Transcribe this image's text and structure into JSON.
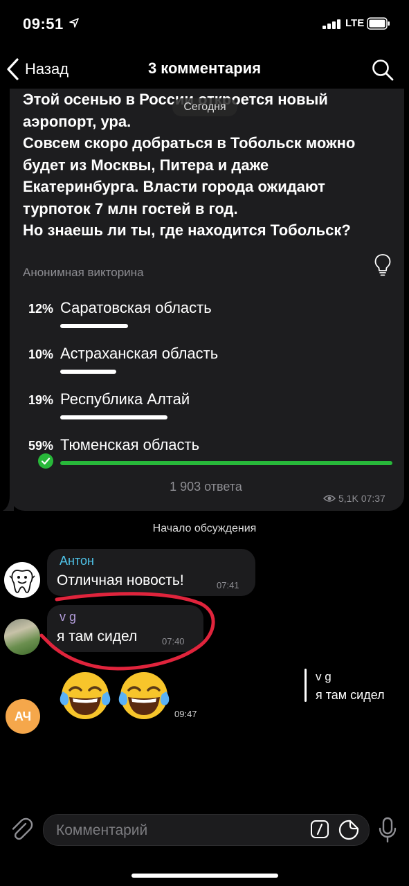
{
  "status_bar": {
    "time": "09:51",
    "network": "LTE"
  },
  "header": {
    "back_label": "Назад",
    "title": "3 комментария"
  },
  "post": {
    "text": "Этой осенью в России откроется новый аэропорт, ура.\nСовсем скоро добраться в Тобольск можно будет из Москвы, Питера и даже Екатеринбурга. Власти города ожидают турпоток 7 млн гостей в год.\nНо знаешь ли ты, где находится Тобольск?",
    "date_pill": "Сегодня",
    "quiz_type": "Анонимная викторина",
    "options": [
      {
        "percent": "12%",
        "label": "Саратовская область",
        "share": 0.12,
        "correct": false
      },
      {
        "percent": "10%",
        "label": "Астраханская область",
        "share": 0.1,
        "correct": false
      },
      {
        "percent": "19%",
        "label": "Республика Алтай",
        "share": 0.19,
        "correct": false
      },
      {
        "percent": "59%",
        "label": "Тюменская область",
        "share": 0.59,
        "correct": true
      }
    ],
    "answers_count": "1 903 ответа",
    "views": "5,1K",
    "time": "07:37"
  },
  "discussion_start": "Начало обсуждения",
  "comments": [
    {
      "author": "Антон",
      "text": "Отличная новость!",
      "time": "07:41",
      "author_color": "#4fc3e8"
    },
    {
      "author": "v g",
      "text": "я там сидел",
      "time": "07:40",
      "author_color": "#b39ddb"
    },
    {
      "avatar_initials": "АЧ",
      "avatar_color": "#f5a74b",
      "emojis": "😂😂",
      "time": "09:47",
      "reply": {
        "author": "v g",
        "text": "я там сидел"
      }
    }
  ],
  "input": {
    "placeholder": "Комментарий"
  },
  "colors": {
    "accent_green": "#28b83a",
    "annotation_red": "#e0243c",
    "bubble": "#1c1c1e"
  },
  "icons": [
    "location-arrow-icon",
    "signal-icon",
    "battery-icon",
    "chevron-left-icon",
    "search-icon",
    "lightbulb-icon",
    "check-icon",
    "eye-icon",
    "paperclip-icon",
    "command-icon",
    "sticker-icon",
    "microphone-icon"
  ]
}
